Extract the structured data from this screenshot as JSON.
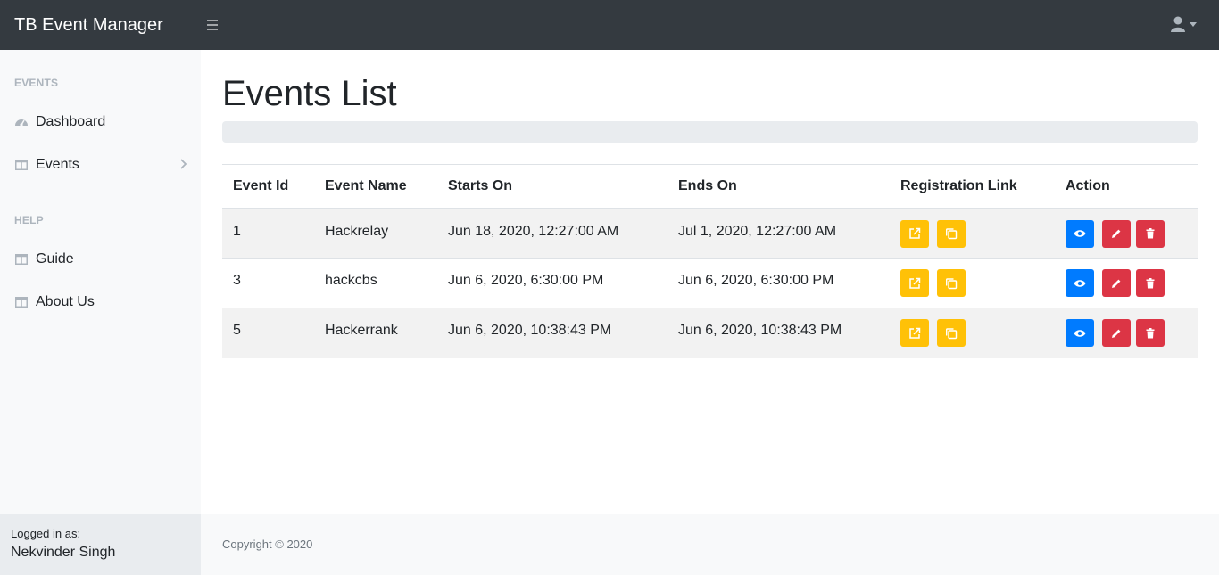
{
  "app": {
    "brand": "TB Event Manager"
  },
  "sidebar": {
    "sections": [
      {
        "heading": "EVENTS"
      },
      {
        "heading": "HELP"
      }
    ],
    "items": [
      {
        "label": "Dashboard",
        "icon": "tachometer-icon"
      },
      {
        "label": "Events",
        "icon": "columns-icon",
        "has_submenu": true
      },
      {
        "label": "Guide",
        "icon": "columns-icon"
      },
      {
        "label": "About Us",
        "icon": "columns-icon"
      }
    ],
    "footer": {
      "label": "Logged in as:",
      "user": "Nekvinder Singh"
    }
  },
  "main": {
    "title": "Events List",
    "table": {
      "headers": [
        "Event Id",
        "Event Name",
        "Starts On",
        "Ends On",
        "Registration Link",
        "Action"
      ],
      "rows": [
        {
          "id": "1",
          "name": "Hackrelay",
          "starts": "Jun 18, 2020, 12:27:00 AM",
          "ends": "Jul 1, 2020, 12:27:00 AM"
        },
        {
          "id": "3",
          "name": "hackcbs",
          "starts": "Jun 6, 2020, 6:30:00 PM",
          "ends": "Jun 6, 2020, 6:30:00 PM"
        },
        {
          "id": "5",
          "name": "Hackerrank",
          "starts": "Jun 6, 2020, 10:38:43 PM",
          "ends": "Jun 6, 2020, 10:38:43 PM"
        }
      ]
    }
  },
  "footer": {
    "copyright": "Copyright © 2020"
  },
  "colors": {
    "topbar": "#343a40",
    "warning": "#ffc107",
    "primary": "#007bff",
    "danger": "#dc3545",
    "sidebar_bg": "#f8f9fa"
  }
}
